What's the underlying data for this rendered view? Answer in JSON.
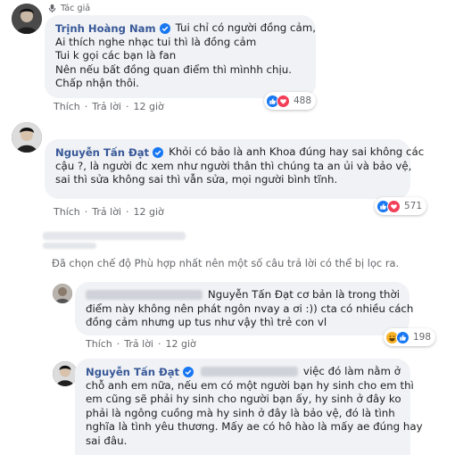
{
  "comment1": {
    "author_badge": "Tác giả",
    "name": "Trịnh Hoàng Nam",
    "lines": [
      "Tui chỉ có người đồng cảm,",
      "Ai thích nghe nhạc tui thì là đồng cảm",
      "Tui k gọi các bạn là fan",
      "Nên nếu bất đồng quan điểm thì mìnhh chịu.",
      "Chấp nhận thôi."
    ],
    "actions": {
      "like": "Thích",
      "reply": "Trả lời",
      "time": "12 giờ"
    },
    "reaction_count": "488",
    "reaction_icons": [
      "like-icon",
      "love-icon"
    ]
  },
  "comment2": {
    "name": "Nguyễn Tấn Đạt",
    "lines": [
      "Khỏi có bảo là anh Khoa đúng hay sai không các",
      "cậu ?, là người đc xem như người thân thì chúng ta an ủi và bảo vệ,",
      "sai thì sửa không sai thì vẫn sửa, mọi người bình tĩnh."
    ],
    "actions": {
      "like": "Thích",
      "reply": "Trả lời",
      "time": "12 giờ"
    },
    "reaction_count": "571",
    "reaction_icons": [
      "like-icon",
      "love-icon"
    ]
  },
  "filter_notice": "Đã chọn chế độ Phù hợp nhất nên một số câu trả lời có thể bị lọc ra.",
  "reply1": {
    "lines": [
      "Nguyễn Tấn Đạt cơ bản là trong thời",
      "điểm này không nên phát ngôn nvay a ơi :)) cta có nhiều cách",
      "đồng cảm nhưng up tus như vậy thì trẻ con vl"
    ],
    "actions": {
      "like": "Thích",
      "reply": "Trả lời",
      "time": "12 giờ"
    },
    "reaction_count": "198",
    "reaction_icons": [
      "haha-icon",
      "like-icon"
    ]
  },
  "reply2": {
    "name": "Nguyễn Tấn Đạt",
    "first_line_end": "việc đó làm nằm ở",
    "lines": [
      "chỗ anh em nữa, nếu em có một người bạn hy sinh cho em thì",
      "em cũng sẽ phải hy sinh cho người bạn ấy, hy sinh ở đây ko",
      "phải là ngông cuồng mà hy sinh ở đây là bảo vệ, đó là tình",
      "nghĩa là tình yêu thương. Mấy ae có hô hào là mấy ae đúng hay",
      "sai đâu."
    ]
  },
  "colors": {
    "name": "#385898",
    "bubble": "#f0f2f5",
    "meta": "#65676b",
    "like": "#1877f2",
    "love": "#f33e58",
    "haha": "#f7b125"
  }
}
